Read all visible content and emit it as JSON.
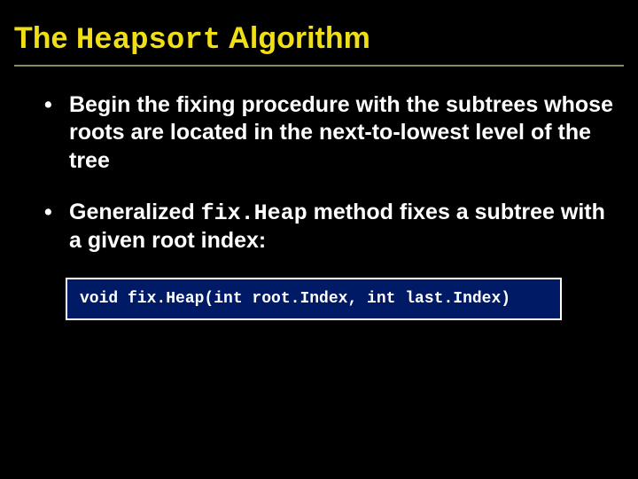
{
  "title": {
    "pre": "The ",
    "mono": "Heapsort",
    "post": " Algorithm"
  },
  "bullets": [
    {
      "pre": "Begin the fixing procedure with the subtrees whose roots are located in the next-to-lowest level of the tree",
      "mono": "",
      "post": ""
    },
    {
      "pre": "Generalized ",
      "mono": "fix.Heap",
      "post": " method fixes a subtree with a given root index:"
    }
  ],
  "code": "void fix.Heap(int root.Index, int last.Index)"
}
